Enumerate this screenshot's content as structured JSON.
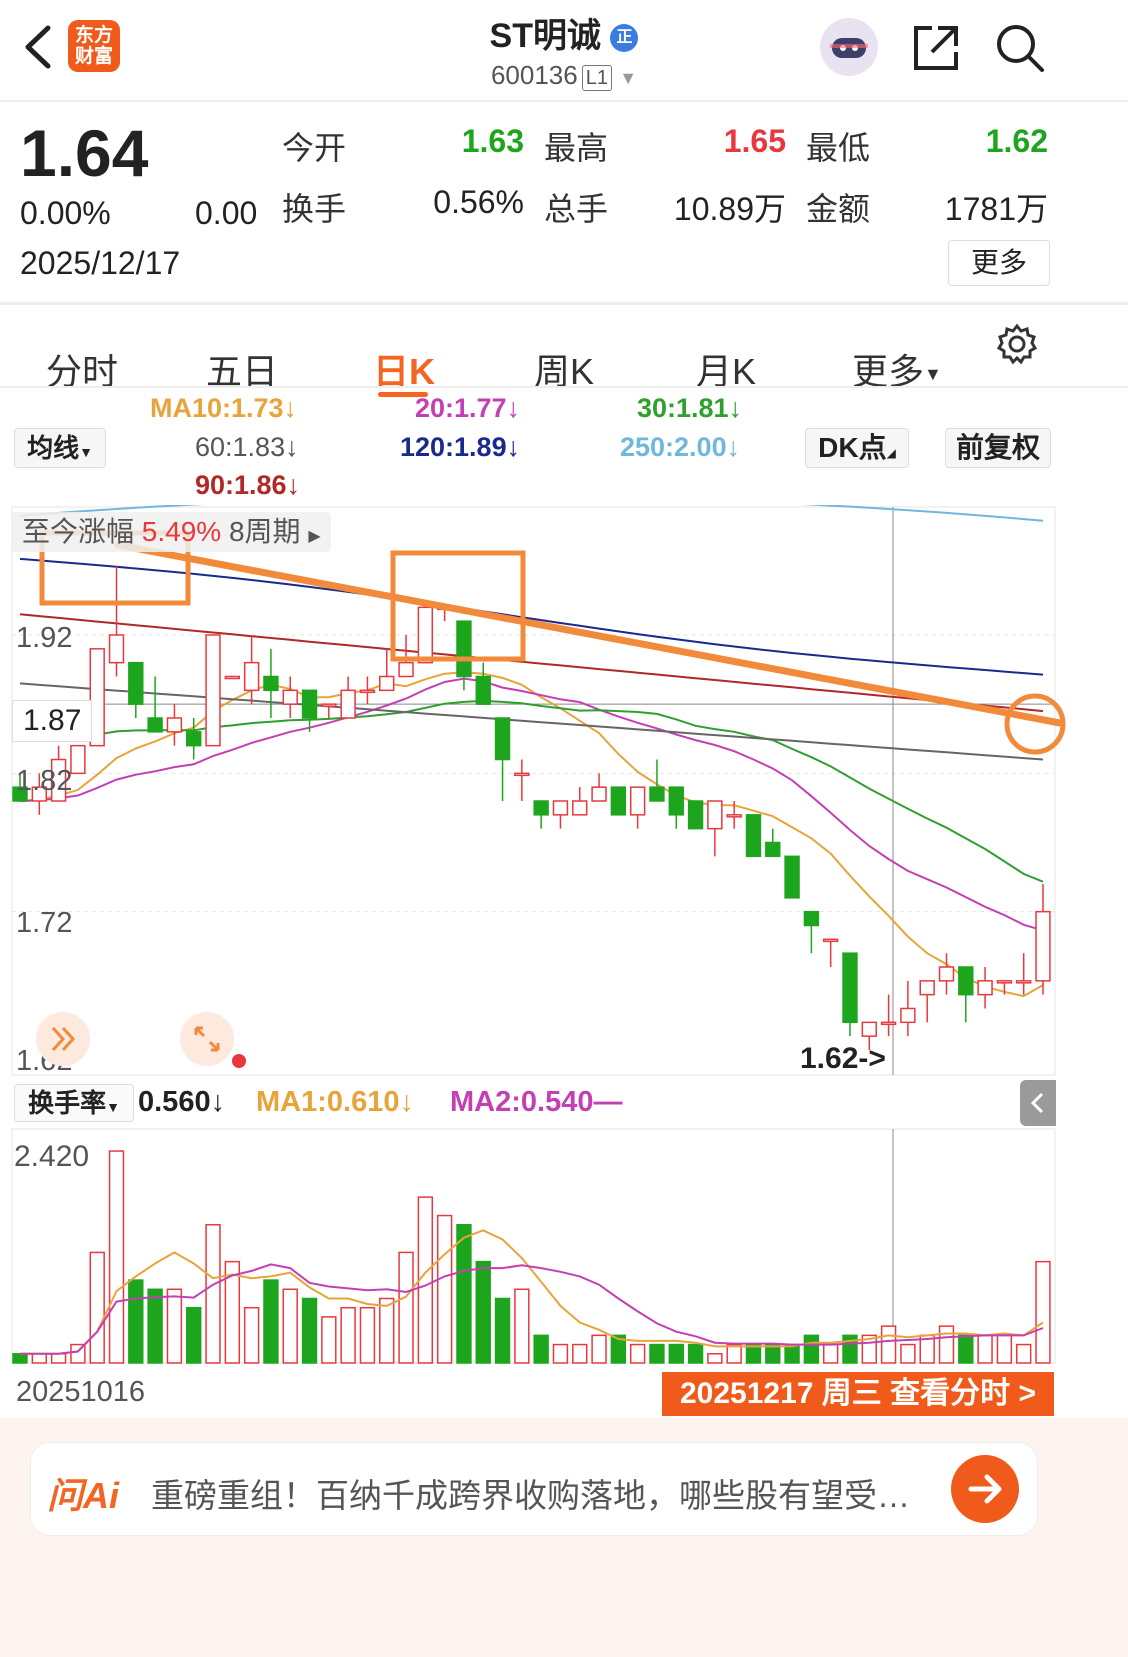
{
  "header": {
    "logo_line1": "东方",
    "logo_line2": "财富",
    "stock_name": "ST明诚",
    "badge": "正",
    "code": "600136",
    "level": "L1"
  },
  "quote": {
    "price": "1.64",
    "change_pct": "0.00%",
    "change": "0.00",
    "date": "2025/12/17",
    "open_label": "今开",
    "open": "1.63",
    "high_label": "最高",
    "high": "1.65",
    "low_label": "最低",
    "low": "1.62",
    "turnover_label": "换手",
    "turnover": "0.56%",
    "volume_label": "总手",
    "volume": "10.89万",
    "amount_label": "金额",
    "amount": "1781万",
    "more": "更多"
  },
  "tabs": [
    "分时",
    "五日",
    "日K",
    "周K",
    "月K",
    "更多"
  ],
  "active_tab": "日K",
  "ma": {
    "selector": "均线",
    "ma10": "MA10:1.73↓",
    "ma20": "20:1.77↓",
    "ma30": "30:1.81↓",
    "ma60": "60:1.83↓",
    "ma120": "120:1.89↓",
    "ma250": "250:2.00↓",
    "ma90": "90:1.86↓",
    "dk": "DK点",
    "fq": "前复权"
  },
  "chart_overlay": {
    "range_label": "至今涨幅",
    "range_pct": "5.49%",
    "range_period": "8周期",
    "low_marker": "1.62->"
  },
  "colors": {
    "up": "#e8383d",
    "down": "#1ea51e",
    "ma10": "#e8a33a",
    "ma20": "#c43fb3",
    "ma30": "#2ea02e",
    "ma60": "#666666",
    "ma90": "#b02828",
    "ma120": "#1a2a8c",
    "ma250": "#6fb8dc",
    "annotation": "#f28a3c",
    "accent": "#f26522"
  },
  "volume": {
    "selector": "换手率",
    "value": "0.560↓",
    "ma1": "MA1:0.610↓",
    "ma2": "MA2:0.540—",
    "axis_max": "2.420"
  },
  "footer": {
    "start_date": "20251016",
    "end_date_button": "20251217 周三 查看分时 >"
  },
  "ai_bar": {
    "logo": "问Ai",
    "text": "重磅重组！百纳千成跨界收购落地，哪些股有望受…"
  },
  "chart_data": {
    "type": "candlestick",
    "y_ticks": [
      "1.92",
      "1.87",
      "1.82",
      "1.72",
      "1.62"
    ],
    "candles": [
      {
        "o": 1.81,
        "h": 1.82,
        "l": 1.8,
        "c": 1.8
      },
      {
        "o": 1.8,
        "h": 1.82,
        "l": 1.79,
        "c": 1.81
      },
      {
        "o": 1.8,
        "h": 1.84,
        "l": 1.8,
        "c": 1.83
      },
      {
        "o": 1.82,
        "h": 1.84,
        "l": 1.82,
        "c": 1.84
      },
      {
        "o": 1.84,
        "h": 1.91,
        "l": 1.84,
        "c": 1.91
      },
      {
        "o": 1.9,
        "h": 1.97,
        "l": 1.89,
        "c": 1.92
      },
      {
        "o": 1.9,
        "h": 1.9,
        "l": 1.86,
        "c": 1.87
      },
      {
        "o": 1.86,
        "h": 1.89,
        "l": 1.85,
        "c": 1.85
      },
      {
        "o": 1.85,
        "h": 1.87,
        "l": 1.84,
        "c": 1.86
      },
      {
        "o": 1.85,
        "h": 1.86,
        "l": 1.83,
        "c": 1.84
      },
      {
        "o": 1.84,
        "h": 1.92,
        "l": 1.84,
        "c": 1.92
      },
      {
        "o": 1.89,
        "h": 1.89,
        "l": 1.89,
        "c": 1.89
      },
      {
        "o": 1.88,
        "h": 1.92,
        "l": 1.87,
        "c": 1.9
      },
      {
        "o": 1.89,
        "h": 1.91,
        "l": 1.86,
        "c": 1.88
      },
      {
        "o": 1.87,
        "h": 1.89,
        "l": 1.86,
        "c": 1.88
      },
      {
        "o": 1.88,
        "h": 1.88,
        "l": 1.85,
        "c": 1.86
      },
      {
        "o": 1.87,
        "h": 1.87,
        "l": 1.86,
        "c": 1.87
      },
      {
        "o": 1.86,
        "h": 1.89,
        "l": 1.86,
        "c": 1.88
      },
      {
        "o": 1.88,
        "h": 1.89,
        "l": 1.87,
        "c": 1.88
      },
      {
        "o": 1.88,
        "h": 1.91,
        "l": 1.88,
        "c": 1.89
      },
      {
        "o": 1.89,
        "h": 1.92,
        "l": 1.89,
        "c": 1.9
      },
      {
        "o": 1.9,
        "h": 1.94,
        "l": 1.9,
        "c": 1.94
      },
      {
        "o": 1.94,
        "h": 1.94,
        "l": 1.93,
        "c": 1.94
      },
      {
        "o": 1.93,
        "h": 1.93,
        "l": 1.88,
        "c": 1.89
      },
      {
        "o": 1.89,
        "h": 1.9,
        "l": 1.87,
        "c": 1.87
      },
      {
        "o": 1.86,
        "h": 1.86,
        "l": 1.8,
        "c": 1.83
      },
      {
        "o": 1.82,
        "h": 1.83,
        "l": 1.8,
        "c": 1.82
      },
      {
        "o": 1.8,
        "h": 1.8,
        "l": 1.78,
        "c": 1.79
      },
      {
        "o": 1.79,
        "h": 1.8,
        "l": 1.78,
        "c": 1.8
      },
      {
        "o": 1.79,
        "h": 1.81,
        "l": 1.79,
        "c": 1.8
      },
      {
        "o": 1.8,
        "h": 1.82,
        "l": 1.8,
        "c": 1.81
      },
      {
        "o": 1.81,
        "h": 1.81,
        "l": 1.79,
        "c": 1.79
      },
      {
        "o": 1.79,
        "h": 1.81,
        "l": 1.78,
        "c": 1.81
      },
      {
        "o": 1.81,
        "h": 1.83,
        "l": 1.8,
        "c": 1.8
      },
      {
        "o": 1.81,
        "h": 1.81,
        "l": 1.78,
        "c": 1.79
      },
      {
        "o": 1.8,
        "h": 1.8,
        "l": 1.78,
        "c": 1.78
      },
      {
        "o": 1.78,
        "h": 1.8,
        "l": 1.76,
        "c": 1.8
      },
      {
        "o": 1.79,
        "h": 1.8,
        "l": 1.78,
        "c": 1.79
      },
      {
        "o": 1.79,
        "h": 1.79,
        "l": 1.76,
        "c": 1.76
      },
      {
        "o": 1.77,
        "h": 1.78,
        "l": 1.76,
        "c": 1.76
      },
      {
        "o": 1.76,
        "h": 1.76,
        "l": 1.73,
        "c": 1.73
      },
      {
        "o": 1.72,
        "h": 1.72,
        "l": 1.69,
        "c": 1.71
      },
      {
        "o": 1.7,
        "h": 1.7,
        "l": 1.68,
        "c": 1.7
      },
      {
        "o": 1.69,
        "h": 1.69,
        "l": 1.63,
        "c": 1.64
      },
      {
        "o": 1.63,
        "h": 1.64,
        "l": 1.62,
        "c": 1.64
      },
      {
        "o": 1.64,
        "h": 1.66,
        "l": 1.63,
        "c": 1.64
      },
      {
        "o": 1.64,
        "h": 1.67,
        "l": 1.63,
        "c": 1.65
      },
      {
        "o": 1.66,
        "h": 1.67,
        "l": 1.64,
        "c": 1.67
      },
      {
        "o": 1.67,
        "h": 1.69,
        "l": 1.66,
        "c": 1.68
      },
      {
        "o": 1.68,
        "h": 1.68,
        "l": 1.64,
        "c": 1.66
      },
      {
        "o": 1.66,
        "h": 1.68,
        "l": 1.65,
        "c": 1.67
      },
      {
        "o": 1.67,
        "h": 1.67,
        "l": 1.66,
        "c": 1.67
      },
      {
        "o": 1.67,
        "h": 1.69,
        "l": 1.66,
        "c": 1.67
      },
      {
        "o": 1.67,
        "h": 1.74,
        "l": 1.66,
        "c": 1.72
      }
    ],
    "turnover": [
      0.1,
      0.1,
      0.1,
      0.2,
      1.2,
      2.3,
      0.9,
      0.8,
      0.8,
      0.6,
      1.5,
      1.1,
      0.6,
      0.9,
      0.8,
      0.7,
      0.5,
      0.6,
      0.6,
      0.7,
      1.2,
      1.8,
      1.6,
      1.5,
      1.1,
      0.7,
      0.8,
      0.3,
      0.2,
      0.2,
      0.3,
      0.3,
      0.2,
      0.2,
      0.2,
      0.2,
      0.1,
      0.2,
      0.2,
      0.2,
      0.2,
      0.3,
      0.2,
      0.3,
      0.3,
      0.4,
      0.2,
      0.3,
      0.4,
      0.3,
      0.3,
      0.3,
      0.2,
      1.1
    ],
    "ma_lines_note": "MA10, MA20, MA30, MA60, MA90, MA120, MA250 overlaid"
  }
}
